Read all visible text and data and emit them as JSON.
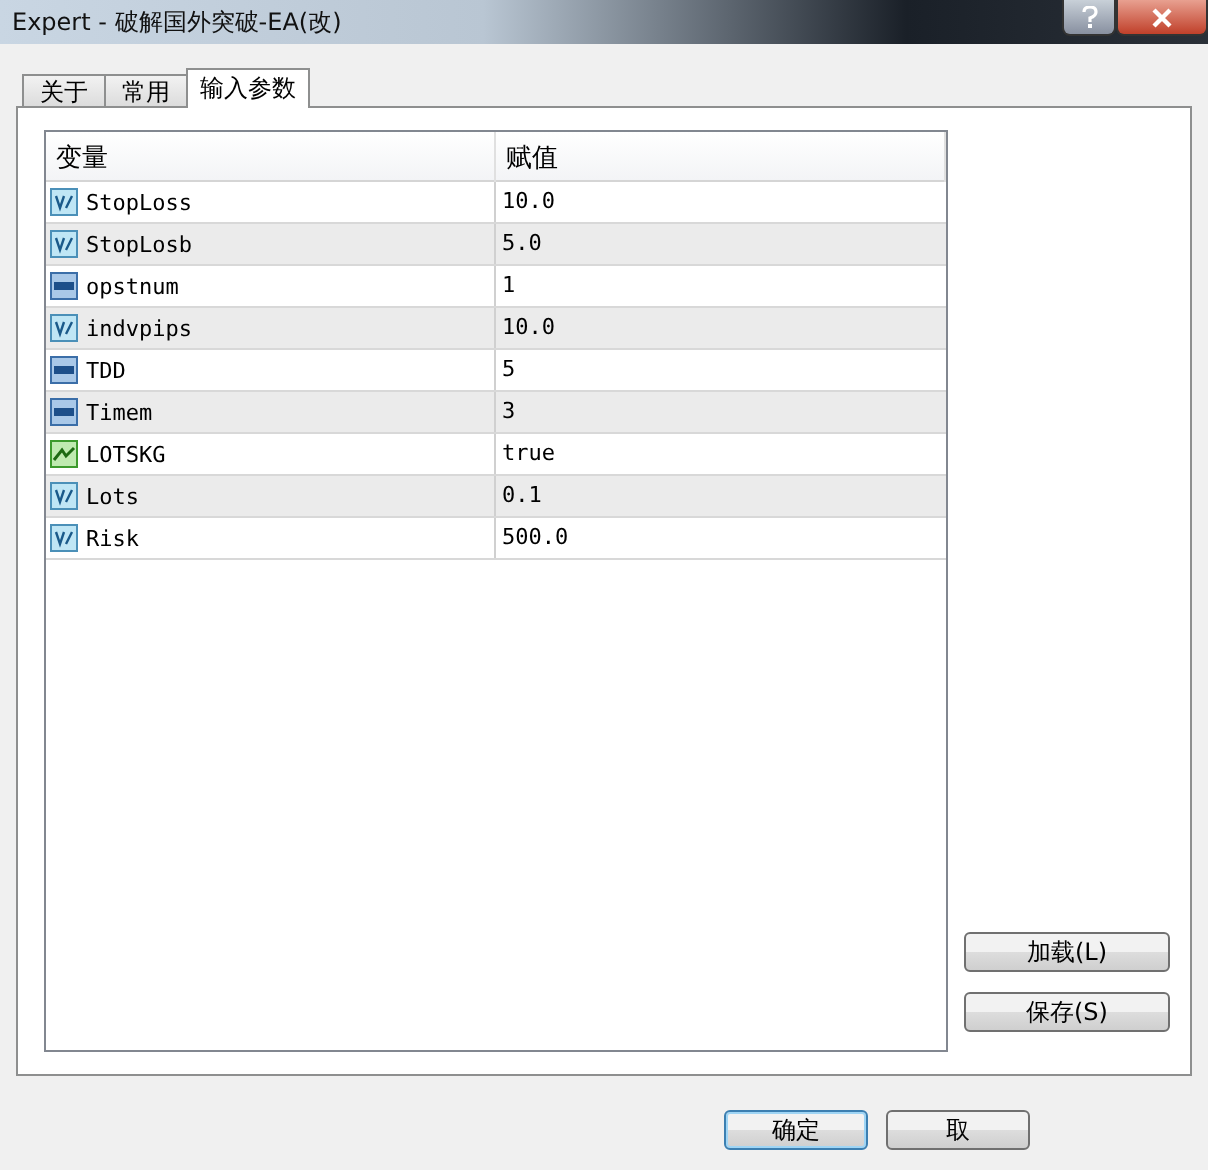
{
  "window": {
    "title": "Expert - 破解国外突破-EA(改)"
  },
  "tabs": [
    {
      "label": "关于",
      "selected": false
    },
    {
      "label": "常用",
      "selected": false
    },
    {
      "label": "输入参数",
      "selected": true
    }
  ],
  "table": {
    "columns": [
      "变量",
      "赋值"
    ],
    "rows": [
      {
        "kind": "double",
        "name": "StopLoss",
        "value": "10.0"
      },
      {
        "kind": "double",
        "name": "StopLosb",
        "value": "5.0"
      },
      {
        "kind": "int",
        "name": "opstnum",
        "value": "1"
      },
      {
        "kind": "double",
        "name": "indvpips",
        "value": "10.0"
      },
      {
        "kind": "int",
        "name": "TDD",
        "value": "5"
      },
      {
        "kind": "int",
        "name": "Timem",
        "value": "3"
      },
      {
        "kind": "bool",
        "name": "LOTSKG",
        "value": "true"
      },
      {
        "kind": "double",
        "name": "Lots",
        "value": "0.1"
      },
      {
        "kind": "double",
        "name": "Risk",
        "value": "500.0"
      }
    ]
  },
  "side_buttons": [
    "加载(L)",
    "保存(S)"
  ],
  "bottom_buttons": [
    "确定",
    "取"
  ]
}
